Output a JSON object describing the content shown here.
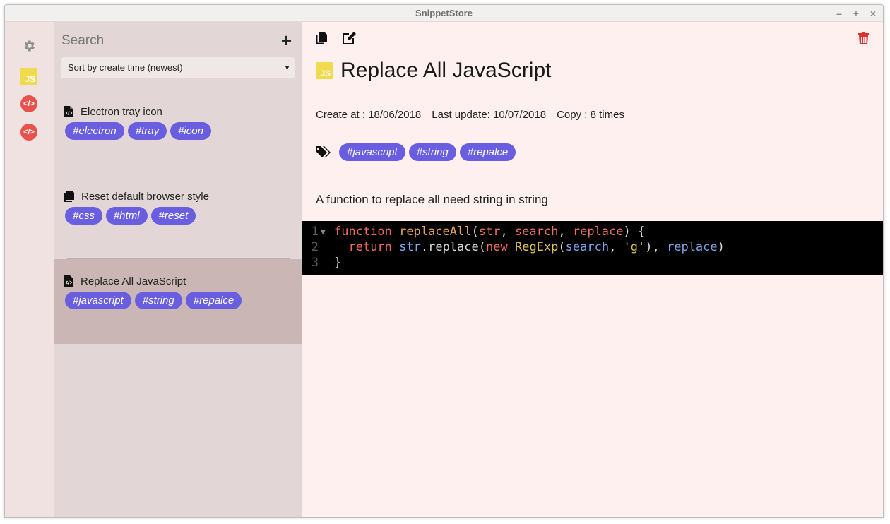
{
  "window": {
    "title": "SnippetStore",
    "controls": {
      "minimize": "–",
      "maximize": "+",
      "close": "×"
    }
  },
  "colors": {
    "tag": "#6a5ee0",
    "active_item": "#c9b6b5",
    "delete": "#e22d2d",
    "js_badge": "#f0db4f",
    "html_badge": "#e7534c"
  },
  "rail": {
    "items": [
      {
        "icon": "gear-icon"
      },
      {
        "icon": "javascript-language-icon",
        "label": "JS"
      },
      {
        "icon": "html-language-icon",
        "label": "</>"
      },
      {
        "icon": "html-language-icon",
        "label": "</>"
      }
    ]
  },
  "list": {
    "search_placeholder": "Search",
    "add_label": "+",
    "sort_value": "Sort by create time (newest)",
    "caret": "▼",
    "snippets": [
      {
        "title": "Electron tray icon",
        "icon": "code-file-icon",
        "tags": [
          "#electron",
          "#tray",
          "#icon"
        ]
      },
      {
        "title": "Reset default browser style",
        "icon": "copy-files-icon",
        "tags": [
          "#css",
          "#html",
          "#reset"
        ]
      },
      {
        "title": "Replace All JavaScript",
        "icon": "code-file-icon",
        "tags": [
          "#javascript",
          "#string",
          "#repalce"
        ]
      }
    ]
  },
  "detail": {
    "lang_badge": "JS",
    "title": "Replace All JavaScript",
    "created": "Create at : 18/06/2018",
    "updated": "Last update: 10/07/2018",
    "copies": "Copy : 8 times",
    "tags": [
      "#javascript",
      "#string",
      "#repalce"
    ],
    "description": "A function to replace all need string in string",
    "code": {
      "line_numbers": [
        "1",
        "2",
        "3"
      ],
      "fold_marker": "▼",
      "line1": {
        "kw": "function",
        "fn": " replaceAll",
        "p1": "(",
        "a1": "str",
        "c1": ", ",
        "a2": "search",
        "c2": ", ",
        "a3": "replace",
        "p2": ") {"
      },
      "line2": {
        "indent": "  ",
        "kw": "return",
        "sp": " ",
        "obj": "str",
        "m": ".replace(",
        "nw": "new",
        "sp2": " ",
        "cls": "RegExp",
        "o": "(",
        "v": "search",
        "cm": ", ",
        "s": "'g'",
        "cp": "), ",
        "v2": "replace",
        "end": ")"
      },
      "line3": {
        "close": "}"
      }
    }
  }
}
